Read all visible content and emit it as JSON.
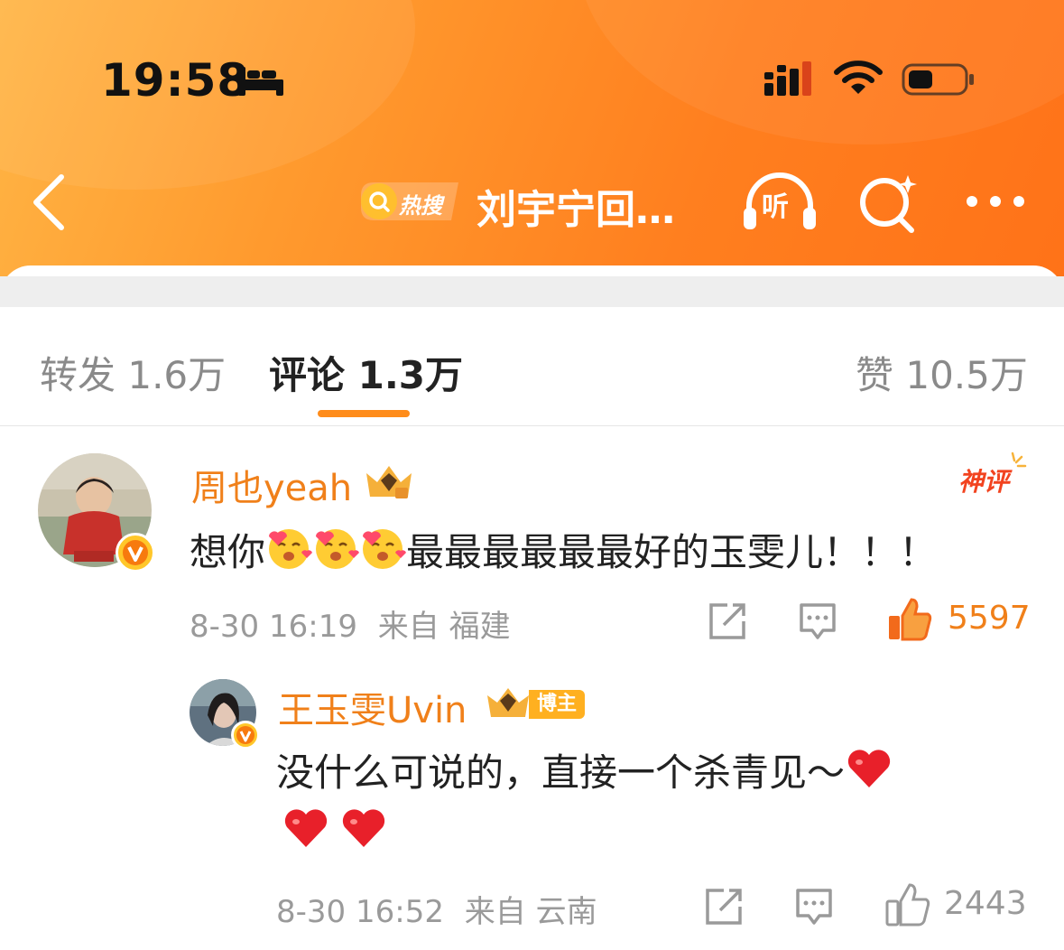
{
  "status_bar": {
    "time": "19:58",
    "icons": [
      "bed-icon",
      "cellular-signal-icon",
      "wifi-icon",
      "battery-icon"
    ]
  },
  "nav": {
    "back_icon": "chevron-left-icon",
    "hot_badge": "热搜",
    "title": "刘宇宁回…",
    "listen_label": "听",
    "search_icon": "search-sparkle-icon",
    "more_icon": "more-dots-icon"
  },
  "tabs": {
    "repost": "转发 1.6万",
    "comment": "评论 1.3万",
    "like": "赞 10.5万",
    "active": "comment"
  },
  "comments": [
    {
      "user": "周也yeah",
      "verified": true,
      "badge": "神评",
      "text_before_emoji": "想你",
      "emoji": [
        "love-face-emoji",
        "love-face-emoji",
        "love-face-emoji"
      ],
      "text_after_emoji": "最最最最最最好的玉雯儿！！！",
      "date": "8-30 16:19",
      "location": "来自 福建",
      "likes": "5597",
      "liked": true
    },
    {
      "user": "王玉雯Uvin",
      "verified": true,
      "badge": "博主",
      "text": "没什么可说的，直接一个杀青见～",
      "emoji": [
        "red-heart-emoji",
        "red-heart-emoji",
        "red-heart-emoji"
      ],
      "date": "8-30 16:52",
      "location": "来自 云南",
      "likes": "2443",
      "liked": false
    }
  ],
  "colors": {
    "header_orange": "#ff7f1f",
    "username_orange": "#f0801a",
    "like_active": "#f0801a",
    "god_comment_red": "#f2431f",
    "meta_gray": "#9a9a9a"
  }
}
